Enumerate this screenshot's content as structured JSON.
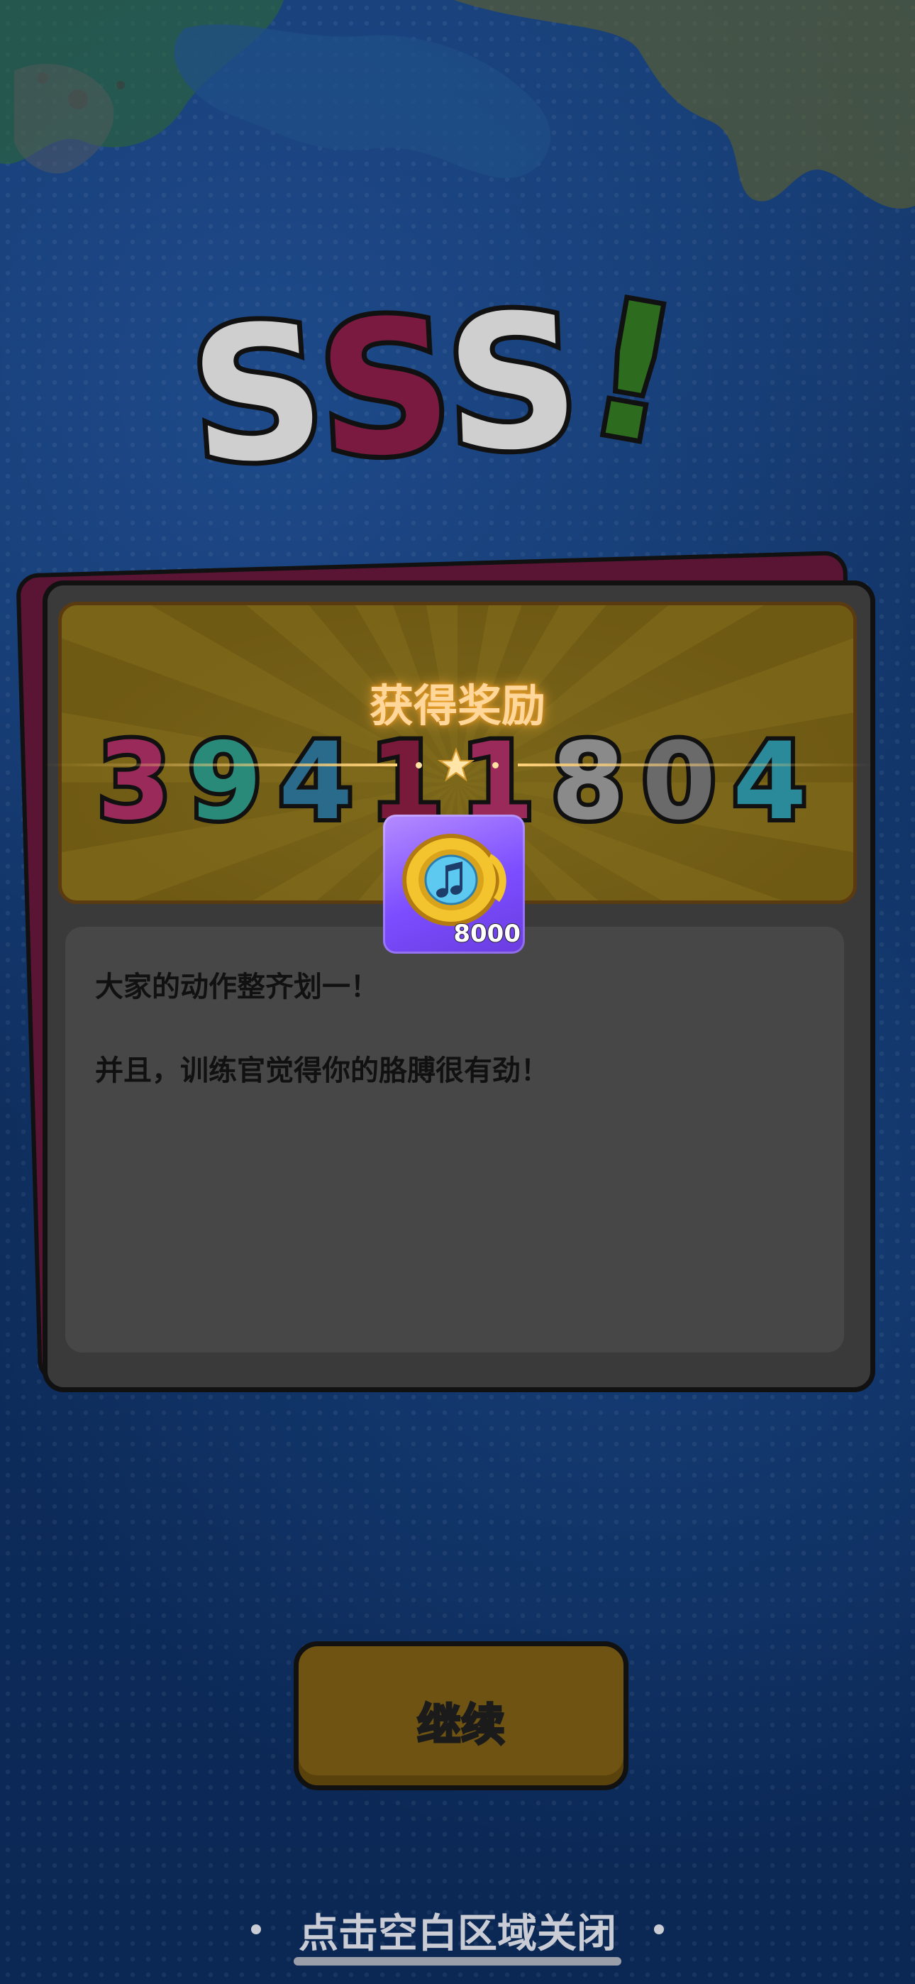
{
  "rank": {
    "label": "SSS!",
    "colors": [
      "#d9d9d9",
      "#8a1a45",
      "#d9d9d9",
      "#2e7a1e"
    ]
  },
  "score": {
    "digits": [
      "3",
      "9",
      "4",
      "1",
      "1",
      "8",
      "0",
      "4"
    ],
    "digit_colors": [
      "#9a2a5a",
      "#2a8a7a",
      "#2a6a8a",
      "#7a1a3a",
      "#9a2a5a",
      "#8a8a8a",
      "#6a6a6a",
      "#2a8a9a"
    ]
  },
  "reward": {
    "title": "获得奖励",
    "item_icon": "music-note-coin-icon",
    "item_count": "8000"
  },
  "messages": {
    "line1": "大家的动作整齐划一！",
    "line2": "并且，训练官觉得你的胳膊很有劲！"
  },
  "buttons": {
    "continue_label": "继续"
  },
  "footer": {
    "close_hint": "点击空白区域关闭"
  },
  "theme": {
    "accent_gold": "#ffd27a",
    "item_bg": "#7b4dff"
  }
}
